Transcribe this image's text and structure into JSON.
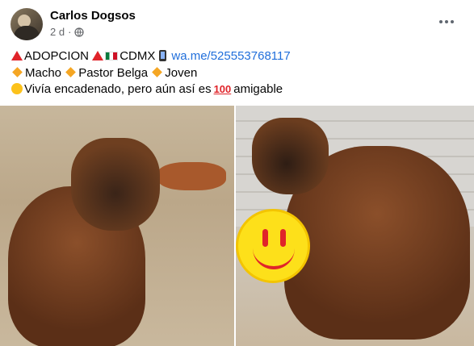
{
  "post": {
    "author": "Carlos Dogsos",
    "time": "2 d",
    "audience_icon": "globe-icon",
    "more_icon": "more-icon",
    "line1": {
      "a": "ADOPCION",
      "b": "CDMX",
      "link": "wa.me/525553768117"
    },
    "line2": {
      "a": "Macho",
      "b": "Pastor Belga",
      "c": "Joven"
    },
    "line3": {
      "a": "Vivía encadenado, pero aún así es",
      "hundred": "100",
      "b": "amigable"
    }
  },
  "colors": {
    "link": "#216fdb",
    "meta": "#65676b"
  }
}
